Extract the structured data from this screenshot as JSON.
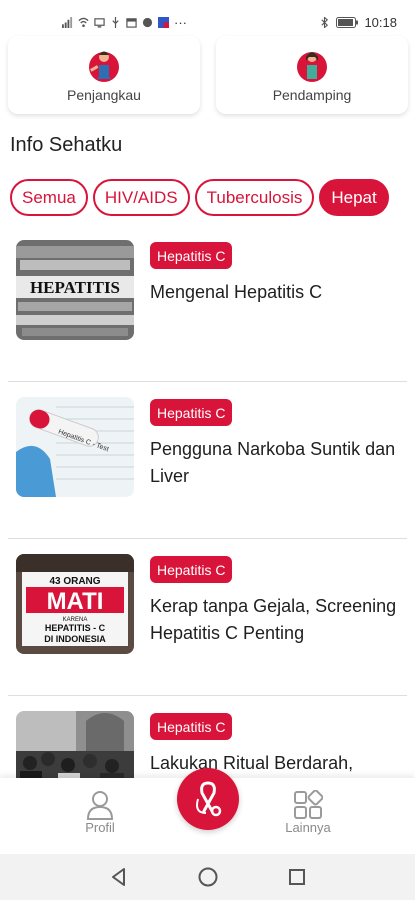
{
  "status_bar": {
    "time": "10:18",
    "more": "···"
  },
  "top_cards": [
    {
      "label": "Penjangkau",
      "icon": "penjangkau-avatar-icon"
    },
    {
      "label": "Pendamping",
      "icon": "pendamping-avatar-icon"
    }
  ],
  "section_title": "Info Sehatku",
  "chips": [
    "Semua",
    "HIV/AIDS",
    "Tuberculosis",
    "Hepat"
  ],
  "active_chip": "Hepat",
  "articles": [
    {
      "category": "Hepatitis C",
      "title": "Mengenal Hepatitis C"
    },
    {
      "category": "Hepatitis C",
      "title": "Pengguna Narkoba Suntik dan Liver"
    },
    {
      "category": "Hepatitis C",
      "title": "Kerap tanpa Gejala, Screening Hepatitis C Penting"
    },
    {
      "category": "Hepatitis C",
      "title": "Lakukan Ritual Berdarah, Penganut Syiah Terinfeksi Virus Hepatitis C"
    }
  ],
  "thumb_texts": {
    "thumb1": "HEPATITIS",
    "thumb2": "Hepatitis C - Test",
    "thumb3_a": "43 ORANG",
    "thumb3_b": "MATI",
    "thumb3_c": "KARENA",
    "thumb3_d": "HEPATITIS - C",
    "thumb3_e": "DI INDONESIA"
  },
  "bottom_nav": {
    "profil": "Profil",
    "lainnya": "Lainnya"
  },
  "colors": {
    "accent": "#d8143a"
  }
}
